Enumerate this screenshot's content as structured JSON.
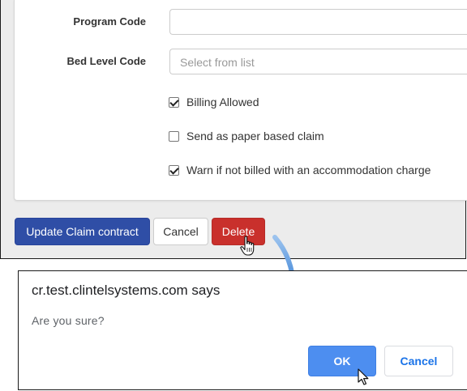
{
  "form": {
    "program_code": {
      "label": "Program Code",
      "value": ""
    },
    "bed_level_code": {
      "label": "Bed Level Code",
      "placeholder": "Select from list"
    },
    "checkboxes": [
      {
        "label": "Billing Allowed",
        "checked": true
      },
      {
        "label": "Send as paper based claim",
        "checked": false
      },
      {
        "label": "Warn if not billed with an accommodation charge",
        "checked": true
      }
    ]
  },
  "actions": {
    "update_label": "Update Claim contract",
    "cancel_label": "Cancel",
    "delete_label": "Delete"
  },
  "dialog": {
    "title": "cr.test.clintelsystems.com says",
    "message": "Are you sure?",
    "ok_label": "OK",
    "cancel_label": "Cancel"
  },
  "colors": {
    "primary": "#2f4ea6",
    "danger": "#c9302c",
    "dialog_ok": "#4d8ef0",
    "arrow": "#4a90d9"
  },
  "icons": [
    "hand-pointer-icon",
    "arrow-pointer-icon",
    "curved-arrow-icon",
    "checkmark-icon"
  ]
}
